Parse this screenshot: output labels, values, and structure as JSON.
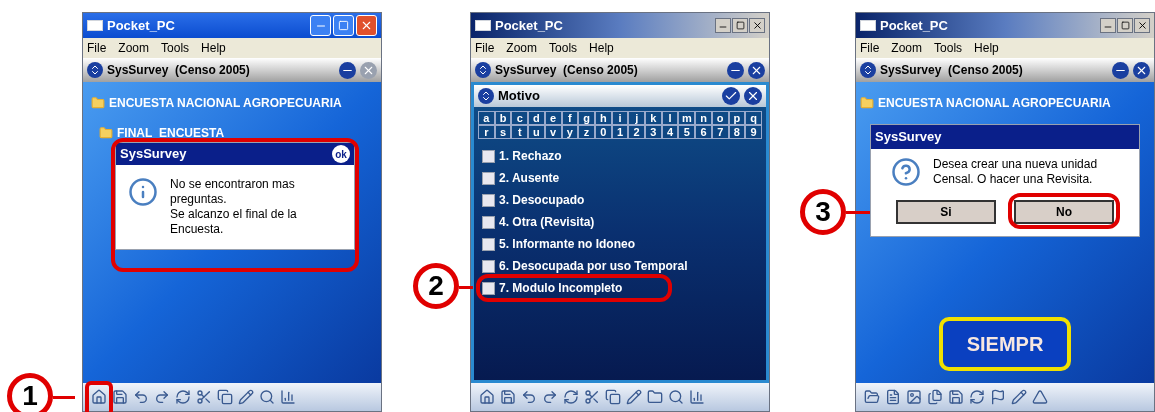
{
  "screens": [
    {
      "kind": "message",
      "window_title": "Pocket_PC",
      "menu": [
        "File",
        "Zoom",
        "Tools",
        "Help"
      ],
      "app_title": "SysSurvey  (Censo 2005)",
      "step": "1",
      "tree": [
        {
          "label": "ENCUESTA NACIONAL AGROPECUARIA",
          "children": [
            {
              "label": "FINAL_ENCUESTA"
            }
          ]
        }
      ],
      "dialog": {
        "title": "SysSurvey",
        "ok": "ok",
        "message": "No se encontraron mas\npreguntas.\nSe alcanzo el final de la\nEncuesta.",
        "highlighted": true
      }
    },
    {
      "kind": "choice",
      "window_title": "Pocket_PC",
      "menu": [
        "File",
        "Zoom",
        "Tools",
        "Help"
      ],
      "app_title": "SysSurvey  (Censo 2005)",
      "step": "2",
      "dialog": {
        "title": "Motivo",
        "keys": [
          [
            "a",
            "b",
            "c",
            "d",
            "e",
            "f",
            "g",
            "h",
            "i",
            "j",
            "k",
            "l",
            "m",
            "n",
            "o",
            "p",
            "q"
          ],
          [
            "r",
            "s",
            "t",
            "u",
            "v",
            "y",
            "z",
            "0",
            "1",
            "2",
            "3",
            "4",
            "5",
            "6",
            "7",
            "8",
            "9"
          ]
        ],
        "options": [
          {
            "label": "1. Rechazo",
            "checked": false,
            "highlighted": false
          },
          {
            "label": "2. Ausente",
            "checked": false,
            "highlighted": false
          },
          {
            "label": "3. Desocupado",
            "checked": false,
            "highlighted": false
          },
          {
            "label": "4. Otra (Revisita)",
            "checked": false,
            "highlighted": false
          },
          {
            "label": "5. Informante no Idoneo",
            "checked": false,
            "highlighted": false
          },
          {
            "label": "6. Desocupada por uso Temporal",
            "checked": false,
            "highlighted": false
          },
          {
            "label": "7. Modulo Incompleto",
            "checked": false,
            "highlighted": true
          }
        ]
      }
    },
    {
      "kind": "question",
      "window_title": "Pocket_PC",
      "menu": [
        "File",
        "Zoom",
        "Tools",
        "Help"
      ],
      "app_title": "SysSurvey  (Censo 2005)",
      "step": "3",
      "tree": [
        {
          "label": "ENCUESTA NACIONAL AGROPECUARIA"
        }
      ],
      "dialog": {
        "title": "SysSurvey",
        "message": "Desea crear una nueva unidad Censal. O hacer una Revisita.",
        "buttons": [
          {
            "label": "Si",
            "highlighted": false
          },
          {
            "label": "No",
            "highlighted": true
          }
        ]
      },
      "banner": {
        "label": "SIEMPR"
      }
    }
  ]
}
